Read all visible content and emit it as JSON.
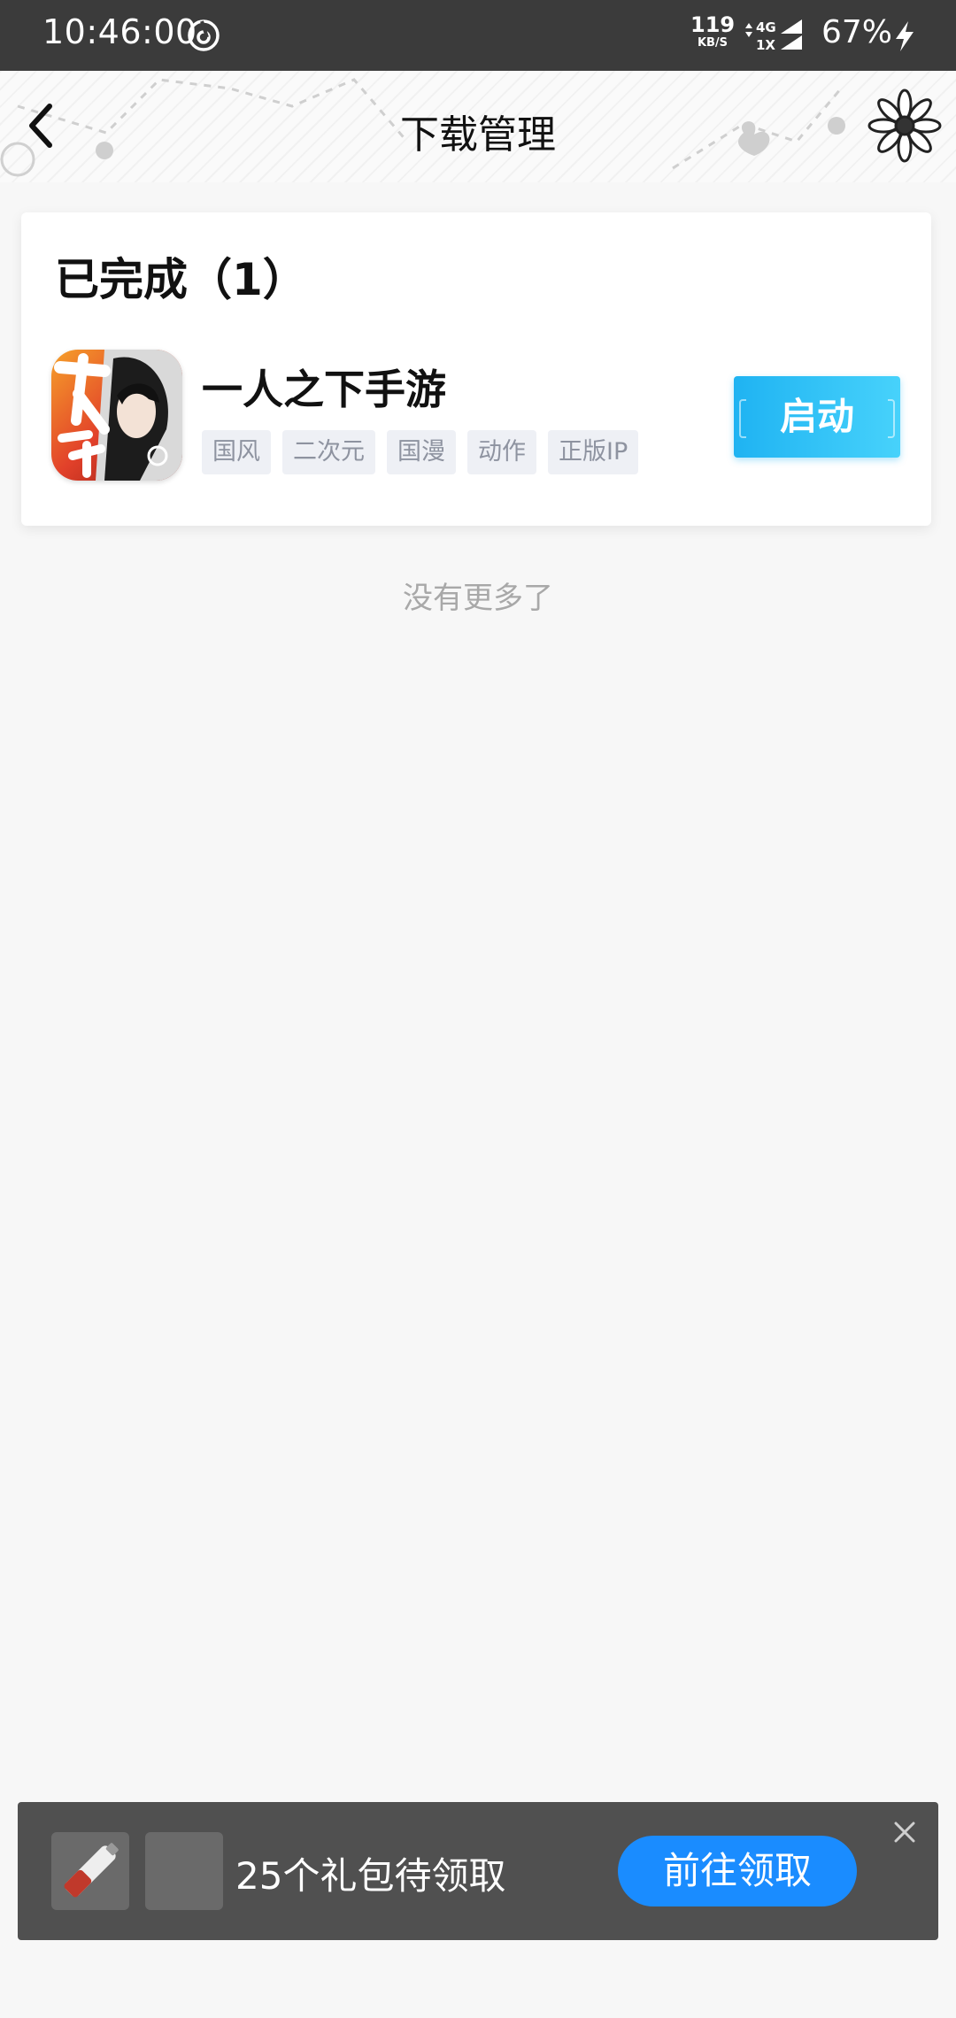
{
  "status_bar": {
    "time": "10:46:00",
    "net_speed": "119",
    "net_speed_unit": "KB/S",
    "network_top": "4G",
    "network_bottom": "1X",
    "battery": "67%"
  },
  "header": {
    "title": "下载管理"
  },
  "downloads": {
    "section_title": "已完成（1）",
    "items": [
      {
        "name": "一人之下手游",
        "tags": [
          "国风",
          "二次元",
          "国漫",
          "动作",
          "正版IP"
        ],
        "action_label": "启动"
      }
    ]
  },
  "footer_text": "没有更多了",
  "gift_banner": {
    "text": "25个礼包待领取",
    "button_label": "前往领取"
  },
  "colors": {
    "status_bar_bg": "#3b3b3b",
    "launch_button": "#1fb3f2",
    "claim_button": "#1a8cff",
    "banner_bg": "#505050",
    "tag_bg": "#eef0f5"
  }
}
